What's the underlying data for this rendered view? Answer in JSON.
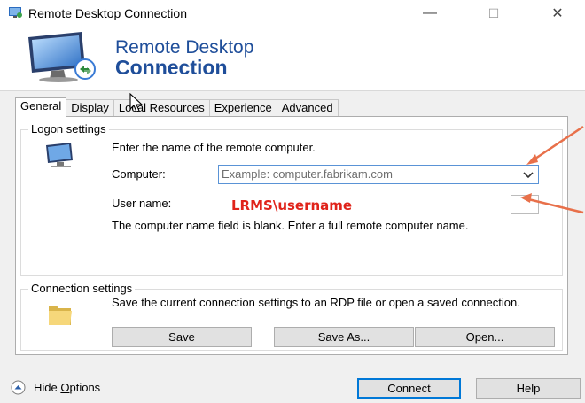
{
  "window": {
    "title": "Remote Desktop Connection",
    "controls": {
      "minimize": "—",
      "maximize": "☐",
      "close": "✕"
    }
  },
  "banner": {
    "line1": "Remote Desktop",
    "line2": "Connection",
    "logo_icon": "monitor-connection-icon"
  },
  "tabs": [
    {
      "label": "General",
      "active": true
    },
    {
      "label": "Display",
      "active": false
    },
    {
      "label": "Local Resources",
      "active": false
    },
    {
      "label": "Experience",
      "active": false
    },
    {
      "label": "Advanced",
      "active": false
    }
  ],
  "logon": {
    "legend": "Logon settings",
    "intro": "Enter the name of the remote computer.",
    "computer_label": "Computer:",
    "computer_placeholder": "Example: computer.fabrikam.com",
    "user_label": "User name:",
    "user_value": "",
    "note": "The computer name field is blank. Enter a full remote computer name."
  },
  "annotation": {
    "text": "LRMS\\username",
    "color": "#e0231a"
  },
  "connection": {
    "legend": "Connection settings",
    "text": "Save the current connection settings to an RDP file or open a saved connection.",
    "save": "Save",
    "save_as": "Save As...",
    "open": "Open..."
  },
  "footer": {
    "hide_options": "Hide Options",
    "connect": "Connect",
    "help": "Help"
  },
  "colors": {
    "brand_text": "#1f4e9a",
    "focus_border": "#0078d7",
    "annotation_arrow": "#e8704a"
  }
}
